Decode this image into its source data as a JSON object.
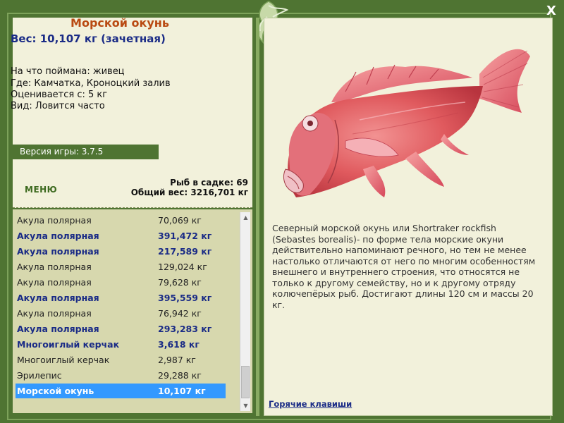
{
  "fish_card": {
    "title": "Морской окунь",
    "weight_line": "Вес: 10,107 кг (зачетная)",
    "caught_on": "На что поймана: живец",
    "location": "Где: Камчатка, Кроноцкий залив",
    "valued_from": "Оценивается с: 5 кг",
    "type": "Вид: Ловится часто"
  },
  "version": "Версия игры: 3.7.5",
  "menu_label": "МЕНЮ",
  "stats": {
    "fish_in_cage": "Рыб в садке: 69",
    "total_weight": "Общий вес: 3216,701 кг"
  },
  "catch_list": [
    {
      "name": "Акула полярная",
      "weight": "70,069 кг",
      "bold": false,
      "selected": false
    },
    {
      "name": "Акула полярная",
      "weight": "391,472 кг",
      "bold": true,
      "selected": false
    },
    {
      "name": "Акула полярная",
      "weight": "217,589 кг",
      "bold": true,
      "selected": false
    },
    {
      "name": "Акула полярная",
      "weight": "129,024 кг",
      "bold": false,
      "selected": false
    },
    {
      "name": "Акула полярная",
      "weight": "79,628 кг",
      "bold": false,
      "selected": false
    },
    {
      "name": "Акула полярная",
      "weight": "395,559 кг",
      "bold": true,
      "selected": false
    },
    {
      "name": "Акула полярная",
      "weight": "76,942 кг",
      "bold": false,
      "selected": false
    },
    {
      "name": "Акула полярная",
      "weight": "293,283 кг",
      "bold": true,
      "selected": false
    },
    {
      "name": "Многоиглый керчак",
      "weight": "3,618 кг",
      "bold": true,
      "selected": false
    },
    {
      "name": "Многоиглый керчак",
      "weight": "2,987 кг",
      "bold": false,
      "selected": false
    },
    {
      "name": "Эрилепис",
      "weight": "29,288 кг",
      "bold": false,
      "selected": false
    },
    {
      "name": "Морской окунь",
      "weight": "10,107 кг",
      "bold": true,
      "selected": true
    }
  ],
  "description": "Северный морской окунь или Shortraker rockfish (Sebastes borealis)- по форме тела морские окуни действительно напоминают речного, но тем не менее настолько отличаются от него по многим особенностям внешнего и внутреннего строения, что относятся не только к другому семейству, но и к другому отряду колючепёрых рыб. Достигают длины 120 см и массы 20 кг.",
  "hotkeys_label": "Горячие клавиши",
  "close_label": "X",
  "icons": {
    "close": "close-icon",
    "ornament": "fish-ornament-icon",
    "scroll_up": "scroll-up-icon",
    "scroll_down": "scroll-down-icon"
  },
  "colors": {
    "frame": "#4f7432",
    "panel": "#f2f1db",
    "list_bg": "#d7d8ae",
    "title": "#b94a12",
    "accent_text": "#1a2b86",
    "selection": "#3399ff"
  }
}
